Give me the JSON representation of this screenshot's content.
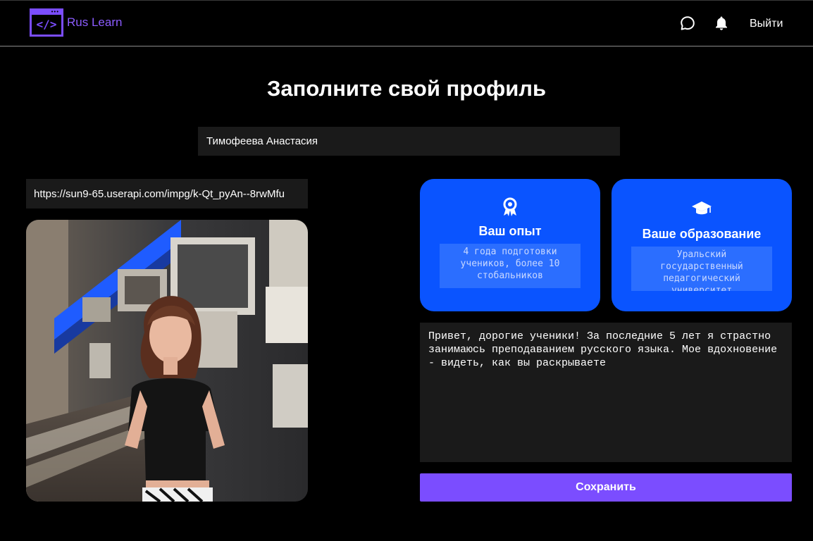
{
  "header": {
    "logo_text": "Rus Learn",
    "logo_icon": "code-window-icon",
    "chat_icon": "chat-bubble-icon",
    "bell_icon": "bell-icon",
    "logout_label": "Выйти"
  },
  "page": {
    "title": "Заполните свой профиль"
  },
  "form": {
    "name_value": "Тимофеева Анастасия",
    "photo_url_value": "https://sun9-65.userapi.com/impg/k-Qt_pyAn--8rwMfu",
    "bio_value": "Привет, дорогие ученики! За последние 5 лет я страстно занимаюсь преподаванием русского языка. Мое вдохновение - видеть, как вы раскрываете",
    "save_label": "Сохранить"
  },
  "cards": {
    "experience": {
      "icon": "award-ribbon-icon",
      "title": "Ваш опыт",
      "value": "4 года подготовки учеников, более 10 стобальников"
    },
    "education": {
      "icon": "graduation-cap-icon",
      "title": "Ваше образование",
      "value": "Уральский государственный педагогический университет"
    }
  },
  "colors": {
    "accent_purple": "#7b4dff",
    "card_blue": "#0a54ff",
    "field_bg": "#1a1a1a",
    "background": "#000000"
  }
}
